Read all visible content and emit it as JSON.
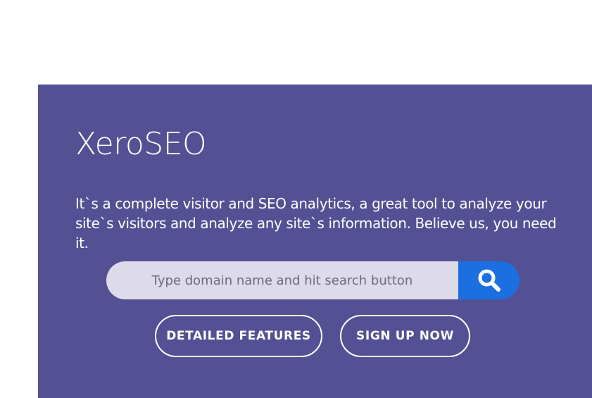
{
  "hero": {
    "title": "XeroSEO",
    "description": "It`s a complete visitor and SEO analytics, a great tool to analyze your site`s visitors and analyze any site`s information. Believe us, you need it.",
    "background_color": "#535093"
  },
  "search": {
    "placeholder": "Type domain name and hit search button",
    "button_icon": "search-icon",
    "button_color": "#1b6fe0"
  },
  "buttons": {
    "features_label": "DETAILED FEATURES",
    "signup_label": "SIGN UP NOW"
  }
}
